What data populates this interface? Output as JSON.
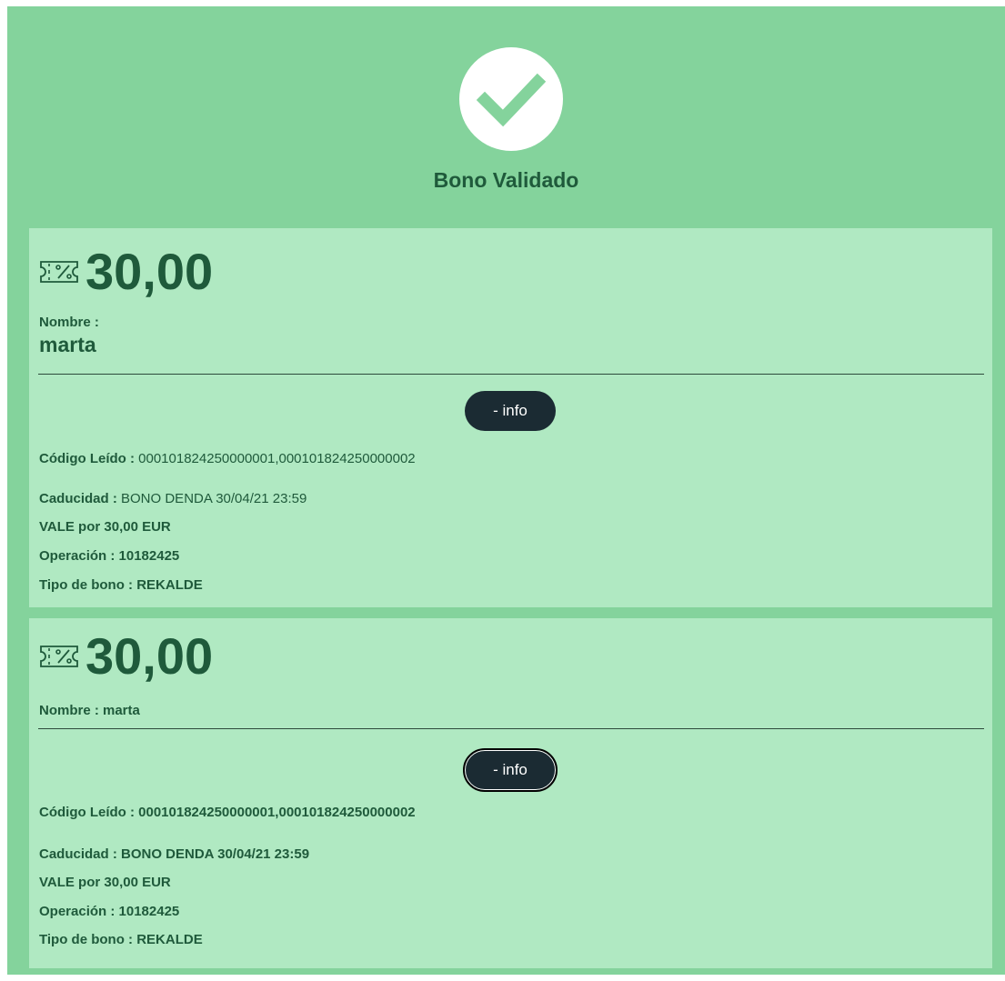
{
  "header": {
    "title": "Bono Validado",
    "icon": "check-icon"
  },
  "colors": {
    "panel_bg": "#84d39c",
    "card_bg": "#b0e9c2",
    "text_dark_green": "#1f5a3b",
    "button_bg": "#1b2b33"
  },
  "cards": [
    {
      "amount": "30,00",
      "amount_icon": "coupon-percent-icon",
      "name_label": "Nombre :",
      "name_value": "marta",
      "info_button": "- info",
      "codigo_label": "Código Leído :",
      "codigo_value": " 000101824250000001,000101824250000002",
      "caducidad_label": "Caducidad :",
      "caducidad_value": " BONO DENDA 30/04/21 23:59",
      "vale": "VALE por 30,00 EUR",
      "operacion": "Operación : 10182425",
      "tipo": "Tipo de bono : REKALDE"
    },
    {
      "amount": "30,00",
      "amount_icon": "coupon-percent-icon",
      "name_line": "Nombre : marta",
      "info_button": "- info",
      "codigo": "Código Leído : 000101824250000001,000101824250000002",
      "caducidad": "Caducidad : BONO DENDA 30/04/21 23:59",
      "vale": "VALE por 30,00 EUR",
      "operacion": "Operación : 10182425",
      "tipo": "Tipo de bono : REKALDE"
    }
  ]
}
